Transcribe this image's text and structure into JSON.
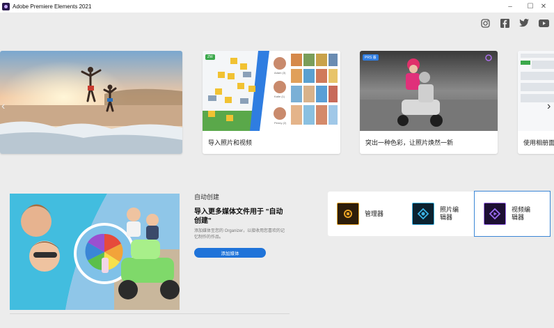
{
  "window": {
    "title": "Adobe Premiere Elements 2021",
    "controls": {
      "minimize": "–",
      "maximize": "☐",
      "close": "✕"
    }
  },
  "social": [
    {
      "name": "instagram-icon"
    },
    {
      "name": "facebook-icon"
    },
    {
      "name": "twitter-icon"
    },
    {
      "name": "youtube-icon"
    }
  ],
  "carousel": {
    "prev_arrow": "‹",
    "next_arrow": "›",
    "cards": [
      {
        "caption": ""
      },
      {
        "caption": "导入照片和视频",
        "tag": "ZW"
      },
      {
        "caption": "突出一种色彩，让照片焕然一新",
        "tag": "PRS 版"
      },
      {
        "caption": "使用相册面"
      }
    ]
  },
  "auto_creation": {
    "section_label": "自动创建",
    "title": "导入更多媒体文件用于 \"自动创建\"",
    "description": "添加媒体至您的 Organizer，以接收用您喜欢的记忆制作的作品。",
    "button_label": "添加媒体"
  },
  "launcher": {
    "tiles": [
      {
        "label": "管理器",
        "color": "#e8a125"
      },
      {
        "label": "照片编辑器",
        "color": "#3bb3e6"
      },
      {
        "label": "视频编辑器",
        "color": "#9b6cf2",
        "selected": true
      }
    ]
  }
}
